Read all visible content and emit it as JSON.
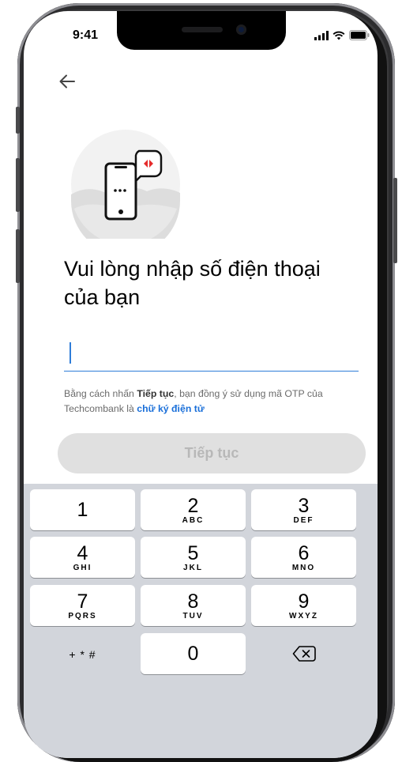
{
  "status_bar": {
    "time": "9:41"
  },
  "page": {
    "title": "Vui lòng nhập số điện thoại của bạn",
    "phone_input": {
      "value": "",
      "placeholder": ""
    },
    "terms": {
      "part1": "Bằng cách nhấn ",
      "bold": "Tiếp tục",
      "part2": ", bạn đồng ý sử dụng mã OTP của Techcombank là ",
      "link": "chữ ký điện tử"
    },
    "continue_label": "Tiếp tục"
  },
  "keypad": {
    "keys": [
      {
        "num": "1",
        "sub": ""
      },
      {
        "num": "2",
        "sub": "ABC"
      },
      {
        "num": "3",
        "sub": "DEF"
      },
      {
        "num": "4",
        "sub": "GHI"
      },
      {
        "num": "5",
        "sub": "JKL"
      },
      {
        "num": "6",
        "sub": "MNO"
      },
      {
        "num": "7",
        "sub": "PQRS"
      },
      {
        "num": "8",
        "sub": "TUV"
      },
      {
        "num": "9",
        "sub": "WXYZ"
      },
      {
        "num": "0",
        "sub": ""
      }
    ],
    "symbols_label": "+ * #"
  },
  "colors": {
    "accent": "#2f7dd8",
    "brand_red": "#e52b2b",
    "keyboard_bg": "#d2d5db",
    "button_disabled": "#e0e0e0"
  }
}
